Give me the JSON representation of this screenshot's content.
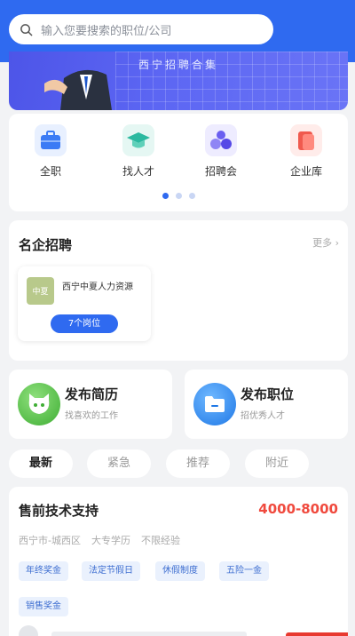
{
  "search": {
    "placeholder": "输入您要搜索的职位/公司"
  },
  "banner": {
    "text": "西宁招聘合集"
  },
  "nav": [
    {
      "label": "全职",
      "icon": "briefcase-icon",
      "color": "#3b7bf5"
    },
    {
      "label": "找人才",
      "icon": "graduation-cap-icon",
      "color": "#2bb9a0"
    },
    {
      "label": "招聘会",
      "icon": "people-icon",
      "color": "#6a5ef0"
    },
    {
      "label": "企业库",
      "icon": "building-icon",
      "color": "#f05a4e"
    }
  ],
  "companies": {
    "title": "名企招聘",
    "more": "更多",
    "items": [
      {
        "logo": "中夏",
        "name": "西宁中夏人力资源",
        "jobs": "7个岗位"
      }
    ]
  },
  "publish": {
    "resume": {
      "title": "发布简历",
      "subtitle": "找喜欢的工作",
      "color": "#4cbf3f"
    },
    "job": {
      "title": "发布职位",
      "subtitle": "招优秀人才",
      "color": "#2f8af2"
    }
  },
  "tabs": [
    "最新",
    "紧急",
    "推荐",
    "附近"
  ],
  "job": {
    "title": "售前技术支持",
    "salary": "4000-8000",
    "location": "西宁市-城西区",
    "education": "大专学历",
    "experience": "不限经验",
    "tags": [
      "年终奖金",
      "法定节假日",
      "休假制度",
      "五险一金",
      "销售奖金"
    ]
  },
  "colors": {
    "primary": "#2f6af0",
    "salary": "#f04a3e",
    "background": "#f2f3f5"
  }
}
